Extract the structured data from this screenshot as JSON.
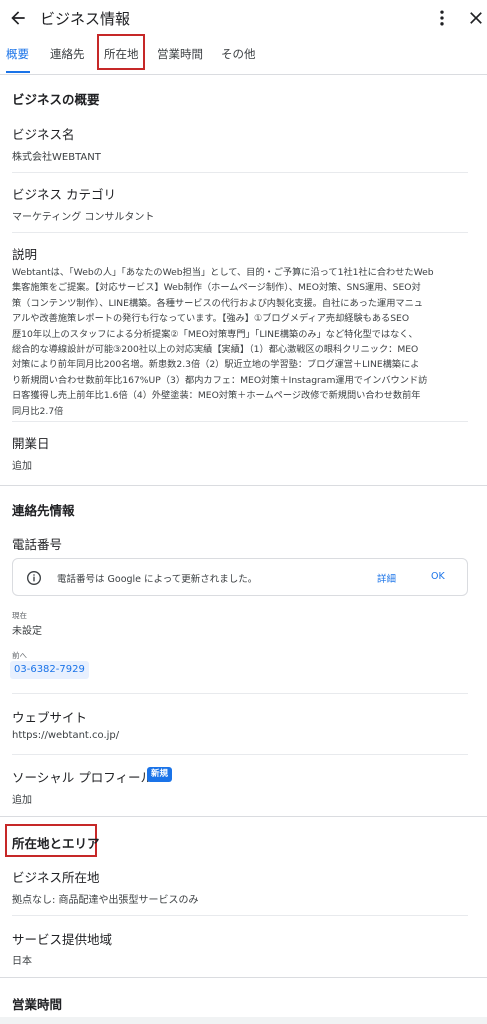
{
  "header": {
    "title": "ビジネス情報"
  },
  "tabs": [
    {
      "label": "概要",
      "active": true
    },
    {
      "label": "連絡先",
      "active": false
    },
    {
      "label": "所在地",
      "active": false,
      "highlighted": true
    },
    {
      "label": "営業時間",
      "active": false
    },
    {
      "label": "その他",
      "active": false
    }
  ],
  "overview": {
    "heading": "ビジネスの概要",
    "business_name": {
      "label": "ビジネス名",
      "value": "株式会社WEBTANT"
    },
    "category": {
      "label": "ビジネス カテゴリ",
      "value": "マーケティング コンサルタント"
    },
    "description": {
      "label": "説明",
      "lines": [
        "Webtantは、「Webの人」「あなたのWeb担当」として、目的・ご予算に沿って1社1社に合わせたWeb",
        "集客施策をご提案。【対応サービス】Web制作（ホームページ制作）、MEO対策、SNS運用、SEO対",
        "策（コンテンツ制作）、LINE構築。各種サービスの代行および内製化支援。自社にあった運用マニュ",
        "アルや改善施策レポートの発行も行なっています。【強み】①ブログメディア売却経験もあるSEO",
        "歴10年以上のスタッフによる分析提案②「MEO対策専門」「LINE構築のみ」など特化型ではなく、",
        "総合的な導線設計が可能③200社以上の対応実績【実績】（1）都心激戦区の眼科クリニック：MEO",
        "対策により前年同月比200名増。新患数2.3倍（2）駅近立地の学習塾：ブログ運営＋LINE構築によ",
        "り新規問い合わせ数前年比167%UP（3）都内カフェ：MEO対策＋Instagram運用でインバウンド訪",
        "日客獲得し売上前年比1.6倍（4）外壁塗装：MEO対策＋ホームページ改修で新規問い合わせ数前年",
        "同月比2.7倍"
      ]
    },
    "opening_date": {
      "label": "開業日",
      "value": "追加"
    }
  },
  "contact": {
    "heading": "連絡先情報",
    "phone": {
      "label": "電話番号",
      "notice": {
        "text": "電話番号は Google によって更新されました。",
        "detail_label": "詳細",
        "ok_label": "OK"
      },
      "current_label": "現在",
      "current_value": "未設定",
      "previous_label": "前へ",
      "previous_value": "03-6382-7929"
    },
    "website": {
      "label": "ウェブサイト",
      "value": "https://webtant.co.jp/"
    },
    "social": {
      "label": "ソーシャル プロフィール",
      "badge": "新規",
      "value": "追加"
    }
  },
  "location": {
    "heading": "所在地とエリア",
    "address": {
      "label": "ビジネス所在地",
      "value": "拠点なし: 商品配達や出張型サービスのみ"
    },
    "service_area": {
      "label": "サービス提供地域",
      "value": "日本"
    }
  },
  "hours": {
    "heading": "営業時間"
  },
  "colors": {
    "accent": "#1a73e8",
    "highlight_box": "#c62828"
  },
  "icons": [
    "back-arrow-icon",
    "more-vert-icon",
    "close-icon",
    "info-icon"
  ]
}
